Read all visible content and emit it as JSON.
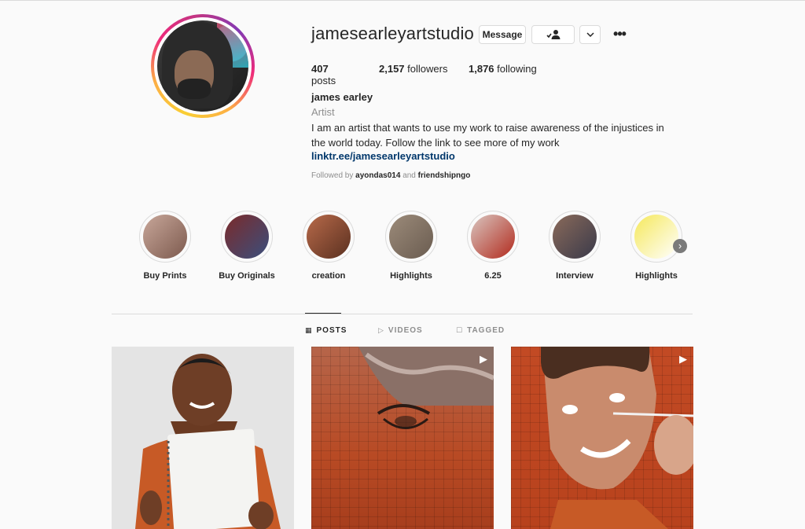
{
  "profile": {
    "username": "jamesearleyartstudio",
    "name": "james earley",
    "category": "Artist",
    "bio": "I am an artist that wants to use my work to raise awareness of the injustices in the world today. Follow the link to see more of my work",
    "link": "linktr.ee/jamesearleyartstudio",
    "followed_by_prefix": "Followed by",
    "followed_by_1": "ayondas014",
    "followed_by_and": "and",
    "followed_by_2": "friendshipngo"
  },
  "actions": {
    "message": "Message",
    "following_icon": "person-check-icon",
    "dropdown_icon": "chevron-down-icon",
    "more": "•••"
  },
  "stats": {
    "posts_count": "407",
    "posts_label": "posts",
    "followers_count": "2,157",
    "followers_label": "followers",
    "following_count": "1,876",
    "following_label": "following"
  },
  "highlights": [
    {
      "label": "Buy Prints",
      "colors": [
        "#c8a79a",
        "#7d5a4e"
      ]
    },
    {
      "label": "Buy Originals",
      "colors": [
        "#7b2a2a",
        "#3a4f7d"
      ]
    },
    {
      "label": "creation",
      "colors": [
        "#b86a4a",
        "#5a3020"
      ]
    },
    {
      "label": "Highlights",
      "colors": [
        "#9c8b7a",
        "#6a5c50"
      ]
    },
    {
      "label": "6.25",
      "colors": [
        "#d9c6c0",
        "#b22a1d"
      ]
    },
    {
      "label": "Interview",
      "colors": [
        "#8a6a5a",
        "#3a3a4a"
      ]
    },
    {
      "label": "Highlights",
      "colors": [
        "#f5e85a",
        "#ffffff"
      ]
    }
  ],
  "tabs": {
    "posts": "POSTS",
    "videos": "VIDEOS",
    "tagged": "TAGGED"
  },
  "colors": {
    "link": "#00376b",
    "muted": "#8e8e8e",
    "text": "#262626"
  }
}
